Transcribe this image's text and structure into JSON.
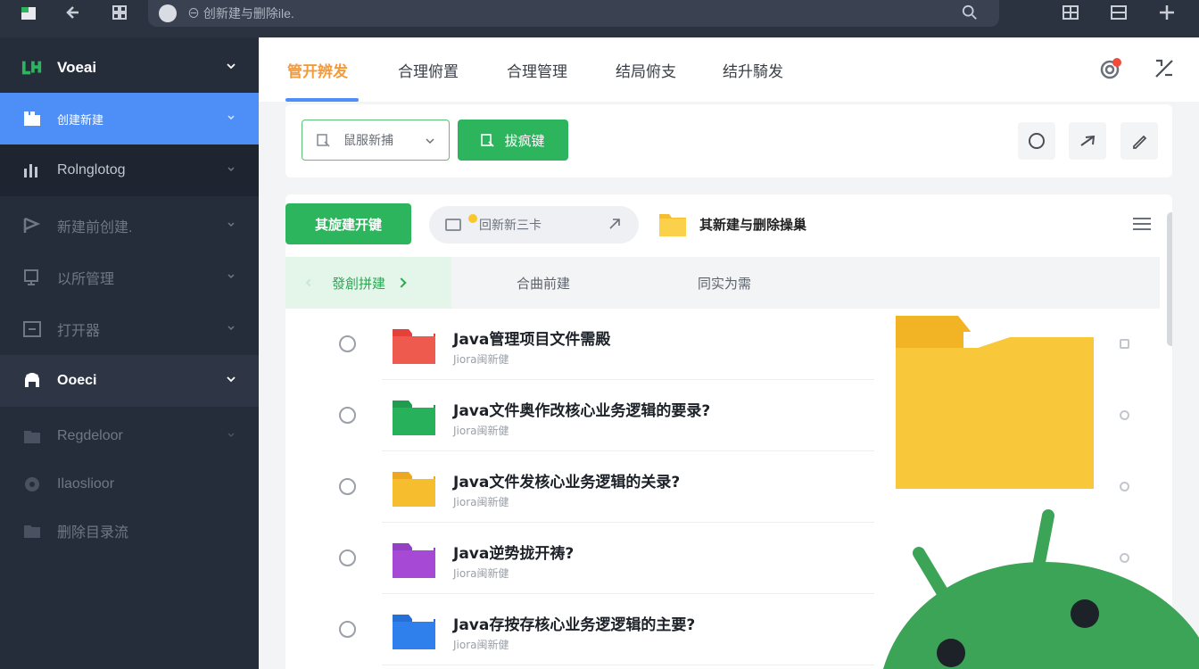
{
  "browser": {
    "address_text": "⊖ 创新建与删除ile."
  },
  "sidebar": {
    "header_label": "Voeai",
    "items": [
      {
        "label": "创建新建"
      },
      {
        "label": "Rolnglotog"
      },
      {
        "label": "新建前创建."
      },
      {
        "label": "以所管理"
      },
      {
        "label": "打开器"
      },
      {
        "label": "Ooeci"
      },
      {
        "label": "Regdeloor"
      },
      {
        "label": "Ilaoslioor"
      },
      {
        "label": "删除目录流"
      }
    ]
  },
  "tabs": [
    {
      "label": "管开辨发"
    },
    {
      "label": "合理俯置"
    },
    {
      "label": "合理管理"
    },
    {
      "label": "结局俯支"
    },
    {
      "label": "结升騎发"
    }
  ],
  "toolbar": {
    "select_label": "鼠服新捕",
    "green_button_label": "拔疯键"
  },
  "panel": {
    "primary_button_label": "其旋建开键",
    "pill_text": "回新新三卡",
    "folder_heading": "其新建与删除操巢"
  },
  "subtabs": [
    {
      "label": "發創拼建"
    },
    {
      "label": "合曲前建"
    },
    {
      "label": "同实为需"
    }
  ],
  "rows": [
    {
      "title": "Java管理项目文件需殿",
      "sub": "Jiora闽新健",
      "color": "#e4413b"
    },
    {
      "title": "Java文件奥作改核心业务逻辑的要录?",
      "sub": "Jiora闽新健",
      "color": "#27b15a"
    },
    {
      "title": "Java文件发核心业务逻辑的关录?",
      "sub": "Jiora闽新健",
      "color": "#f6bd2f"
    },
    {
      "title": "Java逆势拢开祷?",
      "sub": "Jiora闽新健",
      "color": "#a64ad6"
    },
    {
      "title": "Java存按存核心业务逻逻辑的主要?",
      "sub": "Jiora闽新健",
      "color": "#2f80ec"
    }
  ],
  "colors": {
    "accent_blue": "#4d8ff7",
    "accent_green": "#2db55d",
    "active_tab": "#f29b3c",
    "sidebar_bg": "#262d3a"
  }
}
